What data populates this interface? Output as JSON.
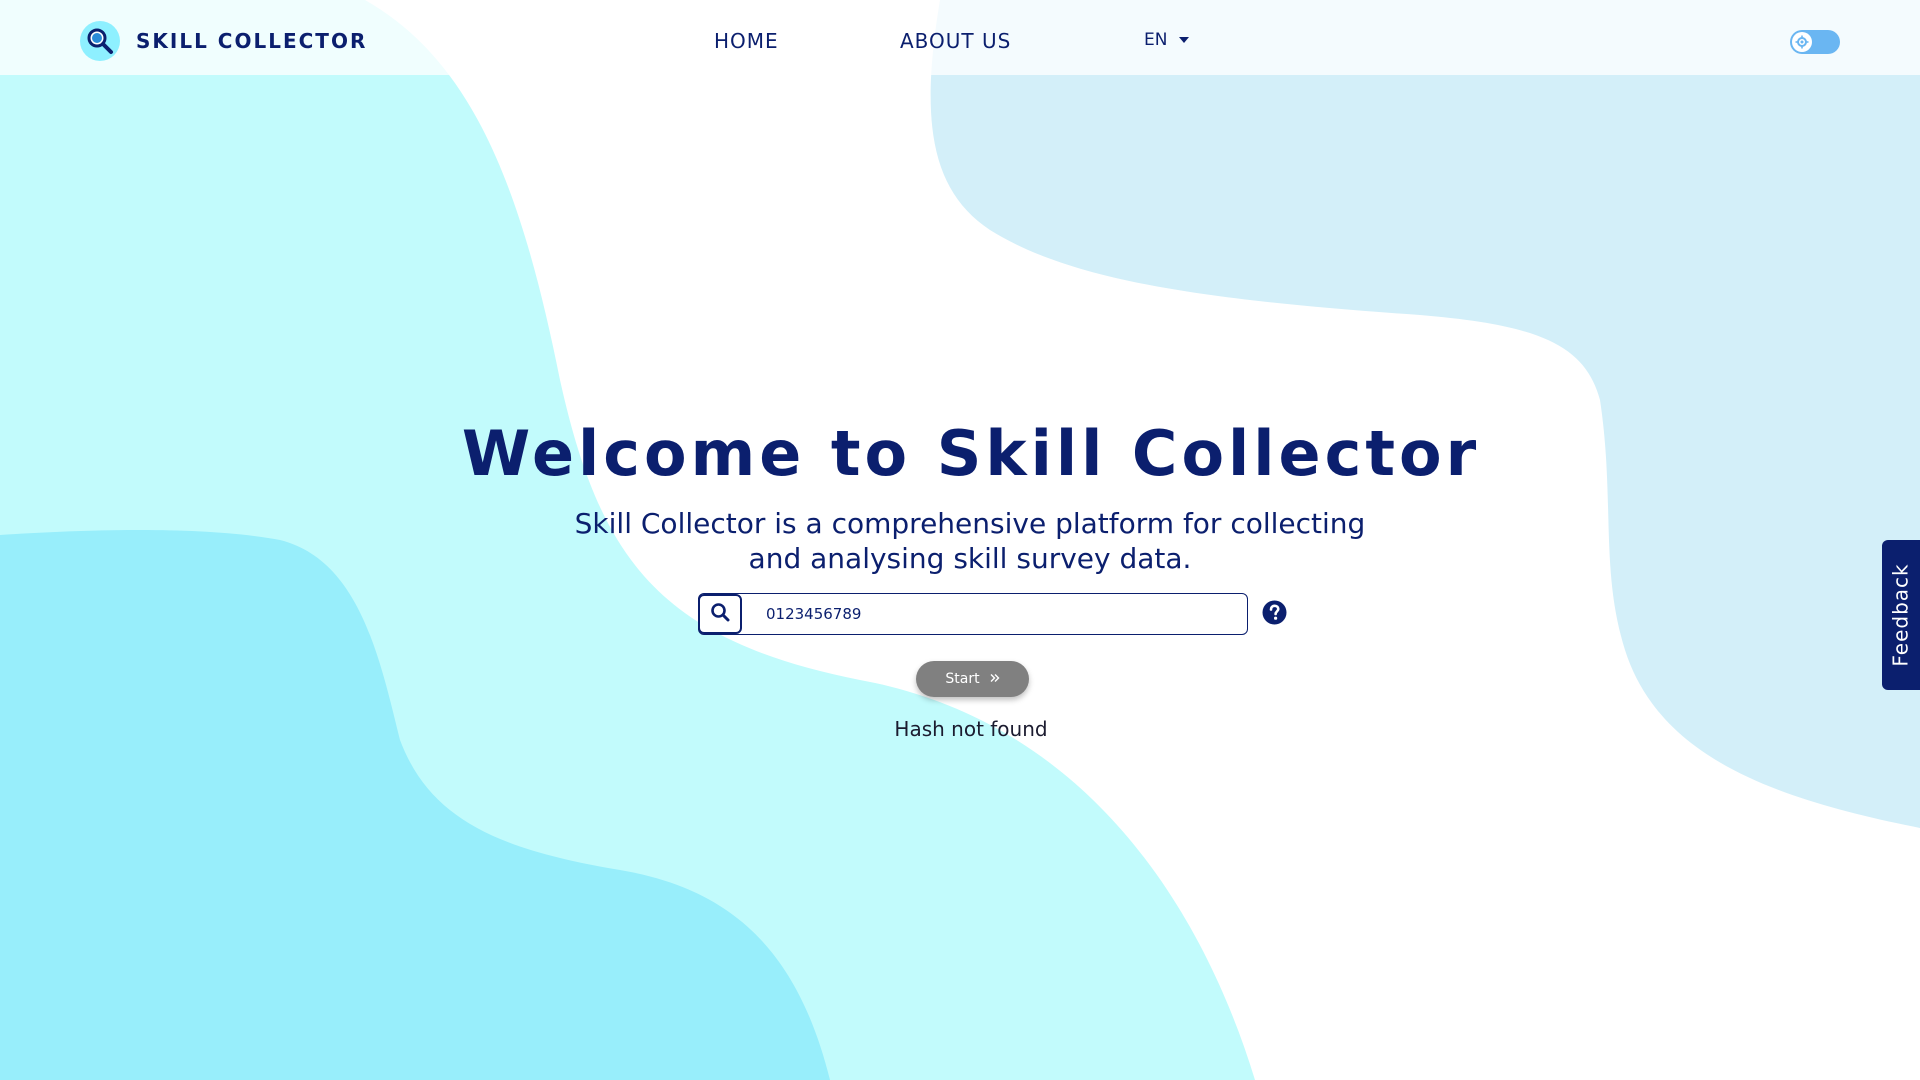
{
  "header": {
    "brand": "SKILL COLLECTOR",
    "nav": [
      {
        "label": "HOME"
      },
      {
        "label": "ABOUT US"
      }
    ],
    "language": "EN"
  },
  "hero": {
    "title": "Welcome to Skill Collector",
    "subtitle": "Skill Collector is a comprehensive platform for collecting and analysing skill survey data.",
    "search": {
      "value": "0123456789"
    },
    "start_label": "Start",
    "status": "Hash not found"
  },
  "feedback_tab": {
    "label": "Feedback"
  },
  "colors": {
    "navy": "#0b1f6e",
    "aqua": "#c2fbfc",
    "cyan": "#98eefb",
    "light_blue": "#d3eff9",
    "button_gray": "#808080"
  },
  "icons": [
    "search-icon",
    "help-icon",
    "chevron-right-icon",
    "gear-icon",
    "caret-down-icon",
    "magnifier-logo-icon"
  ]
}
